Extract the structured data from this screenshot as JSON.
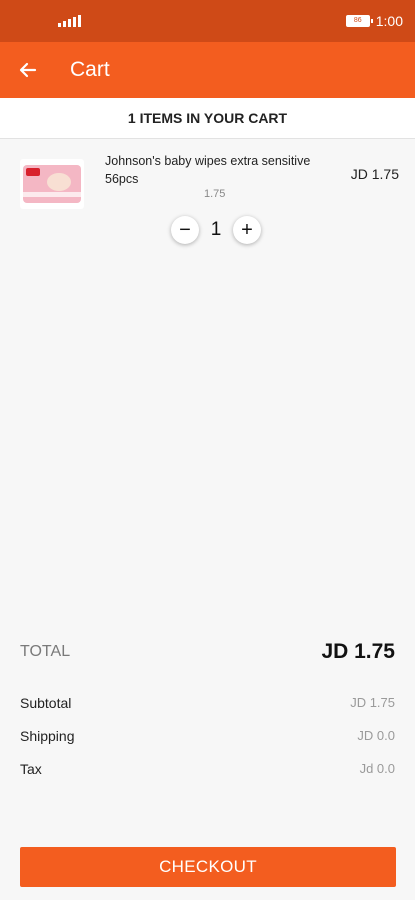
{
  "status_bar": {
    "battery": "86",
    "time": "1:00"
  },
  "app_bar": {
    "title": "Cart",
    "back_icon": "arrow-left-icon"
  },
  "cart": {
    "header": "1 ITEMS IN YOUR CART",
    "items": [
      {
        "name": "Johnson's baby wipes extra sensitive 56pcs",
        "unit_price": "1.75",
        "price": "JD 1.75",
        "quantity": "1",
        "decrease_label": "−",
        "increase_label": "+"
      }
    ]
  },
  "summary": {
    "total_label": "TOTAL",
    "total_value": "JD 1.75",
    "rows": [
      {
        "label": "Subtotal",
        "value": "JD 1.75"
      },
      {
        "label": "Shipping",
        "value": "JD 0.0"
      },
      {
        "label": "Tax",
        "value": "Jd 0.0"
      }
    ]
  },
  "checkout_label": "CHECKOUT",
  "colors": {
    "status_bar": "#cf4a17",
    "accent": "#f35d1f",
    "background": "#f7f7f7"
  }
}
